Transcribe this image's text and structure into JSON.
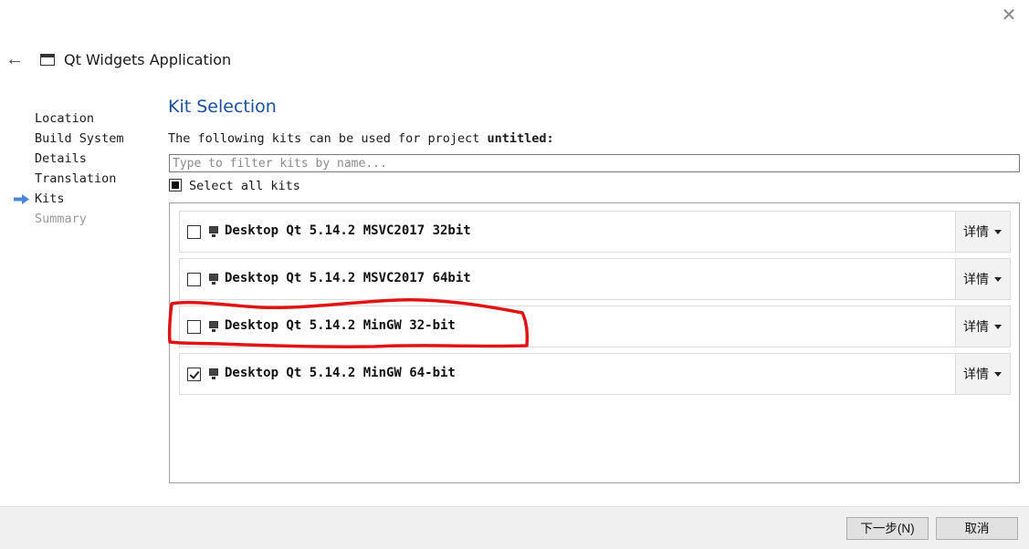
{
  "window": {
    "close_glyph": "✕",
    "back_glyph": "←",
    "app_title": "Qt Widgets Application"
  },
  "steps": [
    {
      "label": "Location",
      "state": "done"
    },
    {
      "label": "Build System",
      "state": "done"
    },
    {
      "label": "Details",
      "state": "done"
    },
    {
      "label": "Translation",
      "state": "done"
    },
    {
      "label": "Kits",
      "state": "current"
    },
    {
      "label": "Summary",
      "state": "pending"
    }
  ],
  "main": {
    "title": "Kit Selection",
    "subtitle_prefix": "The following kits can be used for project ",
    "project_name": "untitled",
    "subtitle_suffix": ":",
    "filter_placeholder": "Type to filter kits by name...",
    "filter_value": "",
    "select_all_label": "Select all kits",
    "select_all_state": "partial"
  },
  "kits": [
    {
      "name": "Desktop Qt 5.14.2 MSVC2017 32bit",
      "checked": false,
      "details_label": "详情"
    },
    {
      "name": "Desktop Qt 5.14.2 MSVC2017 64bit",
      "checked": false,
      "details_label": "详情"
    },
    {
      "name": "Desktop Qt 5.14.2 MinGW 32-bit",
      "checked": false,
      "details_label": "详情"
    },
    {
      "name": "Desktop Qt 5.14.2 MinGW 64-bit",
      "checked": true,
      "details_label": "详情"
    }
  ],
  "annotation": {
    "color": "#e01414",
    "target": "Desktop Qt 5.14.2 MinGW 32-bit"
  },
  "footer": {
    "next_label": "下一步(N)",
    "cancel_label": "取消"
  },
  "colors": {
    "title_blue": "#1a4fa0",
    "step_arrow": "#4a86d8"
  }
}
